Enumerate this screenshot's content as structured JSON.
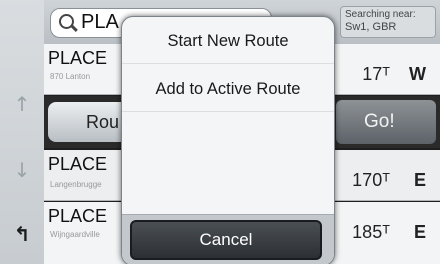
{
  "search": {
    "query": "PLA",
    "near_label": "Searching near:",
    "near_value": "Sw1, GBR"
  },
  "results": [
    {
      "name": "PLACE",
      "address": "870 Lanton",
      "distance": "17ᵀ",
      "direction": "W"
    },
    {
      "name": "PLACE",
      "address": "Langenbrugge",
      "distance": "170ᵀ",
      "direction": "E"
    },
    {
      "name": "PLACE",
      "address": "Wijngaardville",
      "distance": "185ᵀ",
      "direction": "E"
    }
  ],
  "actions": {
    "route_label": "Rou",
    "go_label": "Go!"
  },
  "nav": {
    "up_icon": "arrow-up-icon",
    "down_icon": "arrow-down-icon",
    "back_icon": "back-icon"
  },
  "modal": {
    "options": [
      "Start New Route",
      "Add to Active Route"
    ],
    "cancel_label": "Cancel"
  }
}
